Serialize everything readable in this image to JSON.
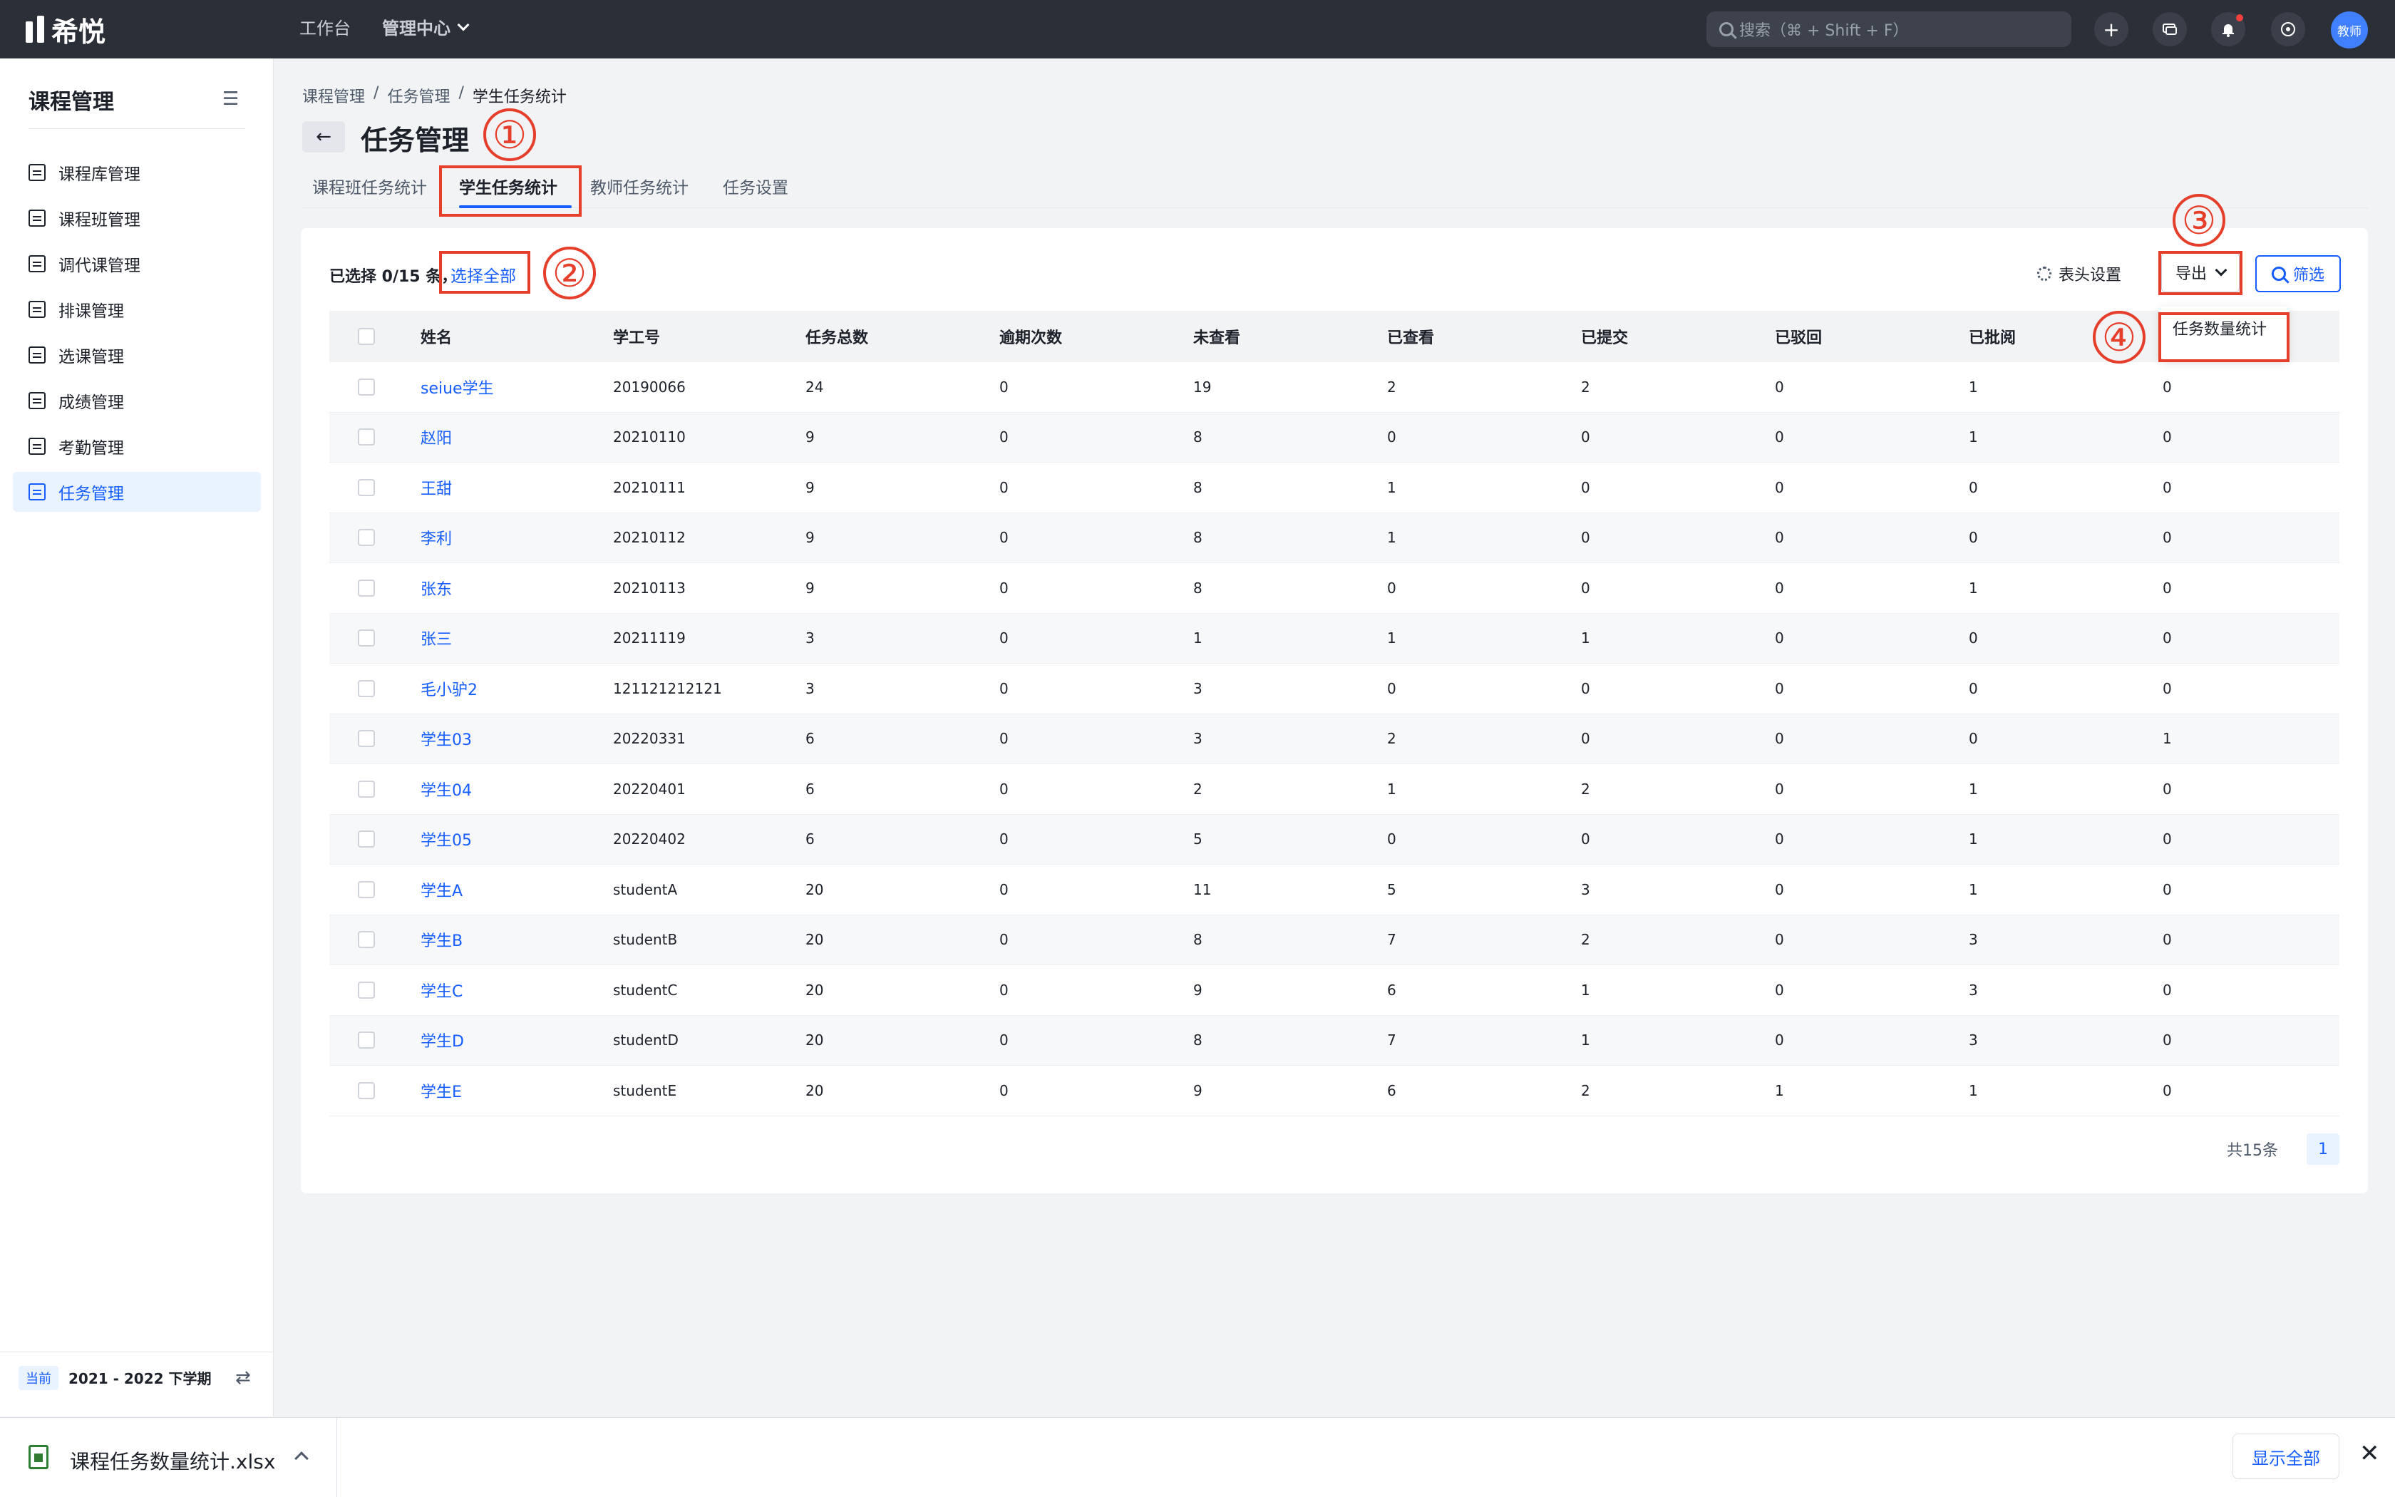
{
  "app": {
    "logo_text": "希悦"
  },
  "topnav": {
    "workbench": "工作台",
    "management": "管理中心"
  },
  "search": {
    "placeholder": "搜索（⌘ + Shift + F）"
  },
  "topicons": {
    "add": "+",
    "user_avatar_text": "教师"
  },
  "sidebar": {
    "title": "课程管理",
    "items": [
      {
        "label": "课程库管理",
        "icon": "course-library-icon"
      },
      {
        "label": "课程班管理",
        "icon": "course-class-icon"
      },
      {
        "label": "调代课管理",
        "icon": "substitute-icon"
      },
      {
        "label": "排课管理",
        "icon": "schedule-icon"
      },
      {
        "label": "选课管理",
        "icon": "course-select-icon"
      },
      {
        "label": "成绩管理",
        "icon": "grade-icon"
      },
      {
        "label": "考勤管理",
        "icon": "attendance-icon"
      },
      {
        "label": "任务管理",
        "icon": "task-icon",
        "active": true
      }
    ],
    "footer": {
      "tag": "当前",
      "term": "2021 - 2022 下学期"
    }
  },
  "breadcrumb": [
    "课程管理",
    "任务管理",
    "学生任务统计"
  ],
  "breadcrumb_sep": "/",
  "page": {
    "title": "任务管理"
  },
  "tabs": [
    "课程班任务统计",
    "学生任务统计",
    "教师任务统计",
    "任务设置"
  ],
  "toolbar": {
    "selection": "已选择 0/15 条，",
    "select_all": "选择全部",
    "column_settings": "表头设置",
    "export": "导出",
    "filter": "筛选",
    "export_menu": [
      "任务数量统计"
    ]
  },
  "table": {
    "headers": [
      "姓名",
      "学工号",
      "任务总数",
      "逾期次数",
      "未查看",
      "已查看",
      "已提交",
      "已驳回",
      "已批阅"
    ],
    "rows": [
      [
        "seiue学生",
        "20190066",
        "24",
        "0",
        "19",
        "2",
        "2",
        "0",
        "1",
        "0"
      ],
      [
        "赵阳",
        "20210110",
        "9",
        "0",
        "8",
        "0",
        "0",
        "0",
        "1",
        "0"
      ],
      [
        "王甜",
        "20210111",
        "9",
        "0",
        "8",
        "1",
        "0",
        "0",
        "0",
        "0"
      ],
      [
        "李利",
        "20210112",
        "9",
        "0",
        "8",
        "1",
        "0",
        "0",
        "0",
        "0"
      ],
      [
        "张东",
        "20210113",
        "9",
        "0",
        "8",
        "0",
        "0",
        "0",
        "1",
        "0"
      ],
      [
        "张三",
        "20211119",
        "3",
        "0",
        "1",
        "1",
        "1",
        "0",
        "0",
        "0"
      ],
      [
        "毛小驴2",
        "121121212121",
        "3",
        "0",
        "3",
        "0",
        "0",
        "0",
        "0",
        "0"
      ],
      [
        "学生03",
        "20220331",
        "6",
        "0",
        "3",
        "2",
        "0",
        "0",
        "0",
        "1"
      ],
      [
        "学生04",
        "20220401",
        "6",
        "0",
        "2",
        "1",
        "2",
        "0",
        "1",
        "0"
      ],
      [
        "学生05",
        "20220402",
        "6",
        "0",
        "5",
        "0",
        "0",
        "0",
        "1",
        "0"
      ],
      [
        "学生A",
        "studentA",
        "20",
        "0",
        "11",
        "5",
        "3",
        "0",
        "1",
        "0"
      ],
      [
        "学生B",
        "studentB",
        "20",
        "0",
        "8",
        "7",
        "2",
        "0",
        "3",
        "0"
      ],
      [
        "学生C",
        "studentC",
        "20",
        "0",
        "9",
        "6",
        "1",
        "0",
        "3",
        "0"
      ],
      [
        "学生D",
        "studentD",
        "20",
        "0",
        "8",
        "7",
        "1",
        "0",
        "3",
        "0"
      ],
      [
        "学生E",
        "studentE",
        "20",
        "0",
        "9",
        "6",
        "2",
        "1",
        "1",
        "0"
      ]
    ]
  },
  "pagination": {
    "total": "共15条",
    "current": "1"
  },
  "annotations": [
    "①",
    "②",
    "③",
    "④"
  ],
  "download_bar": {
    "filename": "课程任务数量统计.xlsx",
    "show_all": "显示全部",
    "close": "✕"
  },
  "colors": {
    "accent": "#165dff",
    "topbar": "#2b2f38",
    "annotation": "#e53e2b"
  }
}
